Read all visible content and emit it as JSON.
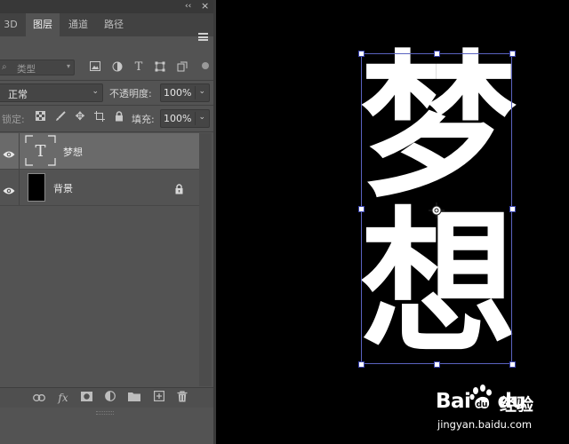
{
  "layers_panel": {
    "collapse_label": "‹‹",
    "close_label": "×",
    "tabs": [
      {
        "label": "3D"
      },
      {
        "label": "图层",
        "active": true
      },
      {
        "label": "通道"
      },
      {
        "label": "路径"
      }
    ],
    "filter": {
      "kind_placeholder": "类型",
      "icons": [
        "image-icon",
        "adjustment-icon",
        "text-type-icon",
        "shape-icon",
        "smart-object-icon"
      ]
    },
    "blend_mode": "正常",
    "opacity_label": "不透明度:",
    "opacity_value": "100%",
    "lock_label": "锁定:",
    "lock_icons": [
      "lock-transparent-icon",
      "lock-image-icon",
      "lock-position-icon",
      "lock-artboard-icon",
      "lock-all-icon"
    ],
    "fill_label": "填充:",
    "fill_value": "100%",
    "layers": [
      {
        "name": "梦想",
        "type": "text",
        "thumb_glyph": "T",
        "selected": true,
        "visible": true
      },
      {
        "name": "背景",
        "type": "background",
        "locked": true,
        "visible": true
      }
    ],
    "bottom_icons": [
      "link-layers-icon",
      "fx-icon",
      "add-mask-icon",
      "adjustment-layer-icon",
      "new-group-icon",
      "new-layer-icon",
      "delete-layer-icon"
    ],
    "fx_label": "fx"
  },
  "canvas": {
    "glyph_top": "梦",
    "glyph_bottom": "想",
    "background_color": "#000000",
    "text_color": "#ffffff",
    "bounding_box_color": "#5a63c0"
  },
  "watermark": {
    "brand": "Bai",
    "brand_suffix": "du",
    "chinese": "经验",
    "url": "jingyan.baidu.com"
  }
}
